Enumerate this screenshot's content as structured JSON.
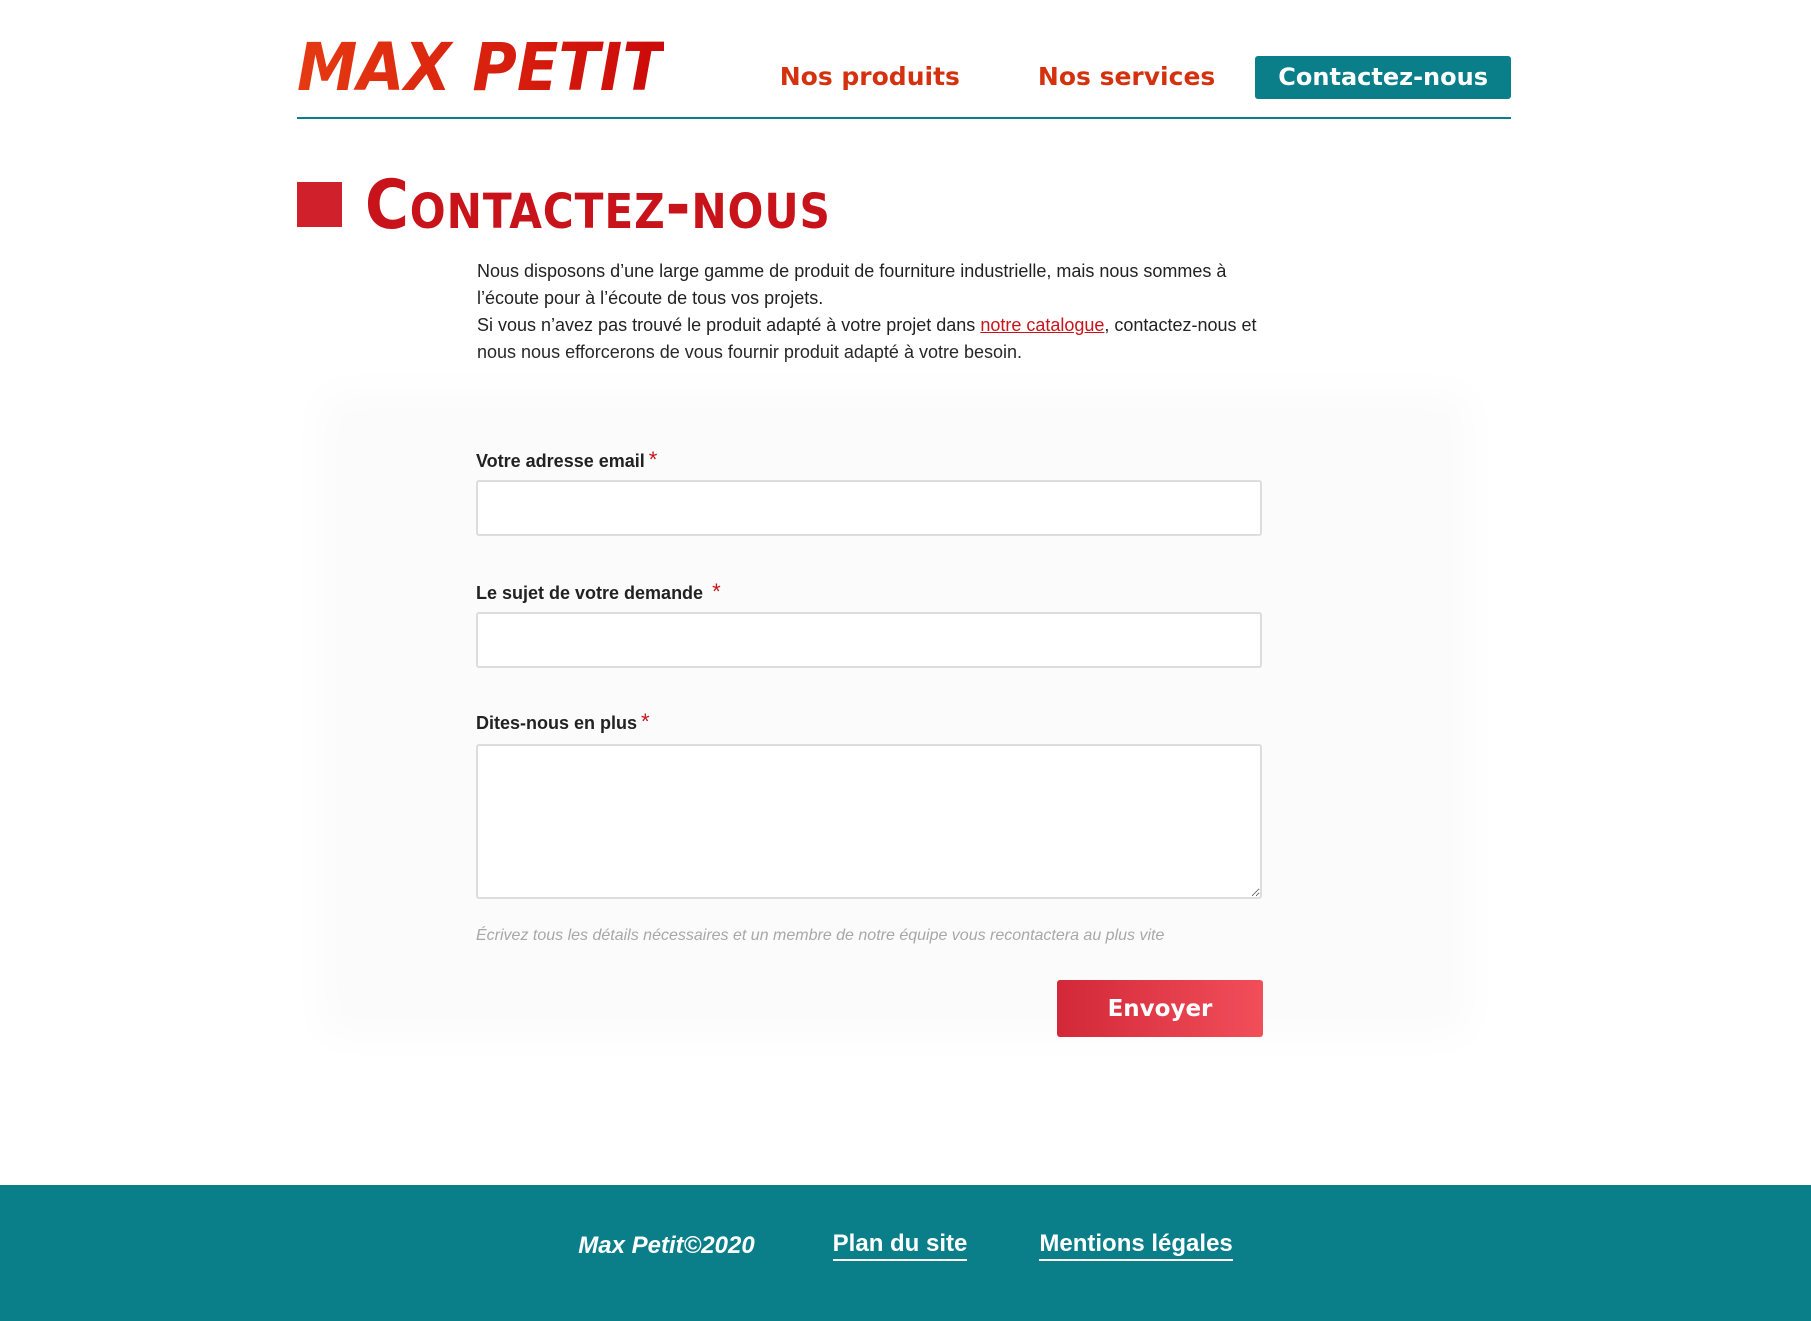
{
  "header": {
    "logo_text": "MAX PETIT",
    "nav": {
      "products_label": "Nos produits",
      "services_label": "Nos services",
      "contact_label": "Contactez-nous"
    }
  },
  "main": {
    "title": "Contactez-nous",
    "intro": {
      "line1": "Nous disposons d’une large gamme de produit de fourniture industrielle, mais nous sommes à l’écoute pour à l’écoute de tous vos projets.",
      "line2_before": "Si vous n’avez pas trouvé le produit adapté à votre projet dans ",
      "catalogue_link": "notre catalogue",
      "line2_after": ", contactez-nous et nous nous efforcerons de vous fournir produit adapté à votre besoin."
    }
  },
  "form": {
    "email_label": "Votre adresse email",
    "email_value": "",
    "subject_label": "Le sujet de votre demande",
    "subject_value": "",
    "message_label": "Dites-nous en plus",
    "message_value": "",
    "required_mark": "*",
    "hint": "Écrivez tous les détails nécessaires et un membre de notre équipe vous recontactera au plus vite",
    "submit_label": "Envoyer"
  },
  "footer": {
    "copyright": "Max Petit©2020",
    "sitemap_label": "Plan du site",
    "legal_label": "Mentions légales"
  },
  "colors": {
    "brand_red": "#c8131b",
    "accent_teal": "#0a7f8a",
    "button_red": "#d22838"
  }
}
